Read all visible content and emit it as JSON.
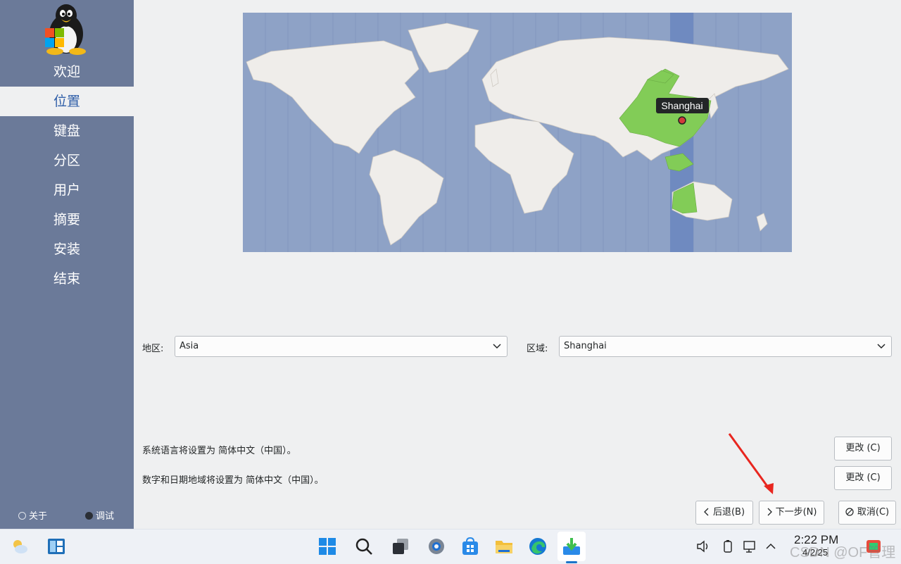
{
  "sidebar": {
    "items": [
      {
        "label": "欢迎"
      },
      {
        "label": "位置"
      },
      {
        "label": "键盘"
      },
      {
        "label": "分区"
      },
      {
        "label": "用户"
      },
      {
        "label": "摘要"
      },
      {
        "label": "安装"
      },
      {
        "label": "结束"
      }
    ],
    "active_index": 1,
    "about_label": "关于",
    "debug_label": "调试"
  },
  "map": {
    "selected_city": "Shanghai",
    "ocean_color": "#8ea2c6",
    "land_color": "#efedea",
    "highlight_color": "#82cc57",
    "timezone_band_color": "#6f8ac0"
  },
  "location": {
    "region_label": "地区:",
    "region_value": "Asia",
    "zone_label": "区域:",
    "zone_value": "Shanghai"
  },
  "locale": {
    "language_text": "系统语言将设置为 简体中文（中国）。",
    "format_text": "数字和日期地域将设置为 简体中文（中国）。",
    "change_language_label": "更改 (C)",
    "change_format_label": "更改 (C)"
  },
  "nav_buttons": {
    "back_label": "后退(B)",
    "next_label": "下一步(N)",
    "cancel_label": "取消(C)"
  },
  "taskbar": {
    "icons": [
      "weather-icon",
      "widgets-icon",
      "start-icon",
      "search-icon",
      "task-view-icon",
      "settings-icon",
      "store-icon",
      "file-explorer-icon",
      "edge-icon",
      "installer-icon"
    ],
    "time": "2:22 PM",
    "date": "4/2/25"
  },
  "watermark": "CSDN @OF管理"
}
